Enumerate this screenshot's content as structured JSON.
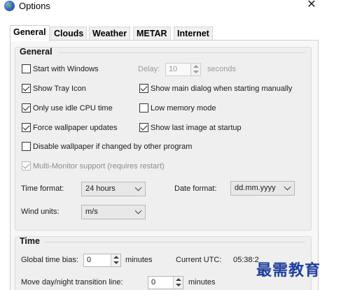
{
  "window": {
    "title": "Options",
    "close_glyph": "✕"
  },
  "tabs": [
    {
      "label": "General",
      "active": true
    },
    {
      "label": "Clouds",
      "active": false
    },
    {
      "label": "Weather",
      "active": false
    },
    {
      "label": "METAR",
      "active": false
    },
    {
      "label": "Internet",
      "active": false
    }
  ],
  "general": {
    "title": "General",
    "start_with_windows": {
      "label": "Start with Windows",
      "checked": false
    },
    "delay": {
      "label": "Delay:",
      "value": "10",
      "unit": "seconds",
      "enabled": false
    },
    "show_tray_icon": {
      "label": "Show Tray Icon",
      "checked": true
    },
    "show_main_dialog": {
      "label": "Show main dialog when starting manually",
      "checked": true
    },
    "idle_cpu": {
      "label": "Only use idle CPU time",
      "checked": true
    },
    "low_memory": {
      "label": "Low memory mode",
      "checked": false
    },
    "force_wallpaper": {
      "label": "Force wallpaper updates",
      "checked": true
    },
    "show_last_image": {
      "label": "Show last image at startup",
      "checked": true
    },
    "disable_wallpaper": {
      "label": "Disable wallpaper if changed by other program",
      "checked": false
    },
    "multi_monitor": {
      "label": "Multi-Monitor support (requires restart)",
      "checked": true,
      "enabled": false
    },
    "time_format": {
      "label": "Time format:",
      "value": "24 hours"
    },
    "date_format": {
      "label": "Date format:",
      "value": "dd.mm.yyyy"
    },
    "wind_units": {
      "label": "Wind units:",
      "value": "m/s"
    }
  },
  "time": {
    "title": "Time",
    "bias": {
      "label": "Global time bias:",
      "value": "0",
      "unit": "minutes"
    },
    "current_utc": {
      "label": "Current UTC:",
      "value": "05:38:2"
    },
    "transition": {
      "label": "Move day/night transition line:",
      "value": "0",
      "unit": "minutes"
    }
  },
  "watermark": {
    "text": "最需教育"
  },
  "icons": {
    "app": "globe-icon",
    "close": "close-icon",
    "check": "checkmark-icon",
    "spin_up": "spin-up-icon",
    "spin_down": "spin-down-icon",
    "dropdown": "chevron-down-icon"
  }
}
